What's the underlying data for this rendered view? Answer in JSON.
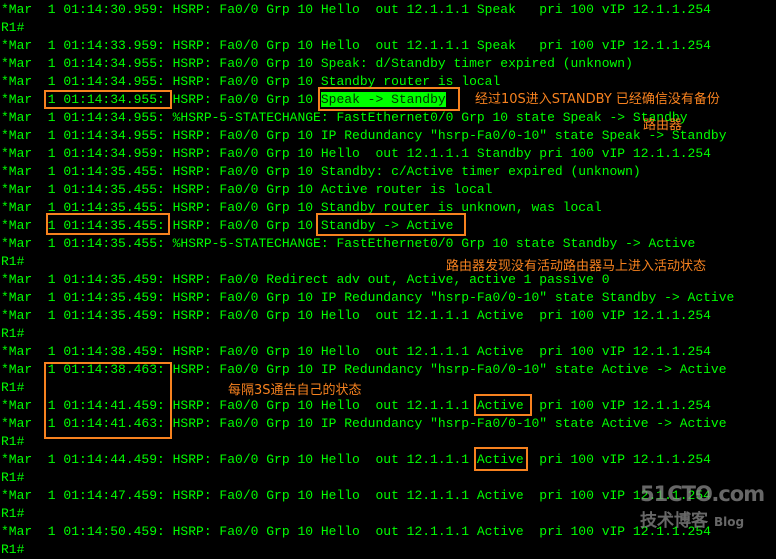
{
  "colors": {
    "text": "#00ff00",
    "background": "#000000",
    "annotation": "#f7821f"
  },
  "lines": [
    "*Mar  1 01:14:30.959: HSRP: Fa0/0 Grp 10 Hello  out 12.1.1.1 Speak   pri 100 vIP 12.1.1.254",
    "R1#",
    "*Mar  1 01:14:33.959: HSRP: Fa0/0 Grp 10 Hello  out 12.1.1.1 Speak   pri 100 vIP 12.1.1.254",
    "*Mar  1 01:14:34.955: HSRP: Fa0/0 Grp 10 Speak: d/Standby timer expired (unknown)",
    "*Mar  1 01:14:34.955: HSRP: Fa0/0 Grp 10 Standby router is local",
    "*Mar  1 01:14:34.955: HSRP: Fa0/0 Grp 10 ",
    "*Mar  1 01:14:34.955: %HSRP-5-STATECHANGE: FastEthernet0/0 Grp 10 state Speak -> Standby",
    "*Mar  1 01:14:34.955: HSRP: Fa0/0 Grp 10 IP Redundancy \"hsrp-Fa0/0-10\" state Speak -> Standby",
    "*Mar  1 01:14:34.959: HSRP: Fa0/0 Grp 10 Hello  out 12.1.1.1 Standby pri 100 vIP 12.1.1.254",
    "*Mar  1 01:14:35.455: HSRP: Fa0/0 Grp 10 Standby: c/Active timer expired (unknown)",
    "*Mar  1 01:14:35.455: HSRP: Fa0/0 Grp 10 Active router is local",
    "*Mar  1 01:14:35.455: HSRP: Fa0/0 Grp 10 Standby router is unknown, was local",
    "*Mar  1 01:14:35.455: HSRP: Fa0/0 Grp 10 Standby -> Active",
    "*Mar  1 01:14:35.455: %HSRP-5-STATECHANGE: FastEthernet0/0 Grp 10 state Standby -> Active",
    "R1#",
    "*Mar  1 01:14:35.459: HSRP: Fa0/0 Redirect adv out, Active, active 1 passive 0",
    "*Mar  1 01:14:35.459: HSRP: Fa0/0 Grp 10 IP Redundancy \"hsrp-Fa0/0-10\" state Standby -> Active",
    "*Mar  1 01:14:35.459: HSRP: Fa0/0 Grp 10 Hello  out 12.1.1.1 Active  pri 100 vIP 12.1.1.254",
    "R1#",
    "*Mar  1 01:14:38.459: HSRP: Fa0/0 Grp 10 Hello  out 12.1.1.1 Active  pri 100 vIP 12.1.1.254",
    "*Mar  1 01:14:38.463: HSRP: Fa0/0 Grp 10 IP Redundancy \"hsrp-Fa0/0-10\" state Active -> Active",
    "R1#",
    "*Mar  1 01:14:41.459: HSRP: Fa0/0 Grp 10 Hello  out 12.1.1.1 Active  pri 100 vIP 12.1.1.254",
    "*Mar  1 01:14:41.463: HSRP: Fa0/0 Grp 10 IP Redundancy \"hsrp-Fa0/0-10\" state Active -> Active",
    "R1#",
    "*Mar  1 01:14:44.459: HSRP: Fa0/0 Grp 10 Hello  out 12.1.1.1 Active  pri 100 vIP 12.1.1.254",
    "R1#",
    "*Mar  1 01:14:47.459: HSRP: Fa0/0 Grp 10 Hello  out 12.1.1.1 Active  pri 100 vIP 12.1.1.254",
    "R1#",
    "*Mar  1 01:14:50.459: HSRP: Fa0/0 Grp 10 Hello  out 12.1.1.1 Active  pri 100 vIP 12.1.1.254",
    "R1#"
  ],
  "highlight": {
    "line": 5,
    "text": "Speak -> Standby"
  },
  "annotations": {
    "standby_note": "经过10S进入STANDBY 已经确信没有备份",
    "standby_note_cont": "路由器",
    "active_note": "路由器发现没有活动路由器马上进入活动状态",
    "hello_note": "每隔3S通告自己的状态"
  },
  "watermark": {
    "site": "51CTO.com",
    "subtitle": "技术博客",
    "blog": "Blog"
  }
}
